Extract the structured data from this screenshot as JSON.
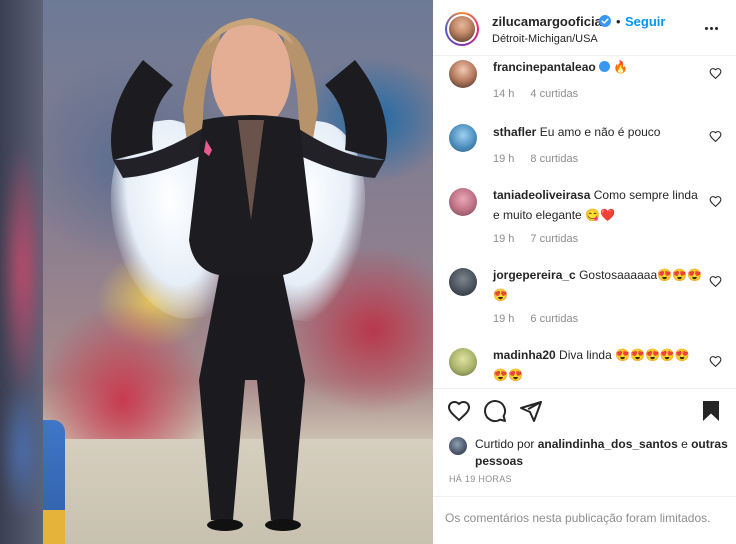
{
  "post": {
    "username": "zilucamargooficial",
    "dot": "•",
    "follow_label": "Seguir",
    "location": "Détroit-Michigan/USA"
  },
  "comments": [
    {
      "user": "francinepantaleao",
      "text": "🔥",
      "time": "14 h",
      "replies": "4 curtidas"
    },
    {
      "user": "sthafler",
      "text": "Eu amo e não é pouco",
      "time": "19 h",
      "replies": "8 curtidas"
    },
    {
      "user": "taniadeoliveirasa",
      "text": "Como sempre linda e muito elegante 😋❤️",
      "time": "19 h",
      "replies": "7 curtidas"
    },
    {
      "user": "jorgepereira_c",
      "text": "Gostosaaaaaa😍😍😍😍",
      "time": "19 h",
      "replies": "6 curtidas"
    },
    {
      "user": "madinha20",
      "text": "Diva linda 😍😍😍😍😍😍😍",
      "time": "",
      "replies": ""
    }
  ],
  "likes": {
    "prefix": "Curtido por ",
    "user": "analindinha_dos_santos",
    "middle": " e ",
    "others": "outras pessoas"
  },
  "timestamp": "HÁ 19 HORAS",
  "limited_notice": "Os comentários nesta publicação foram limitados.",
  "colors": {
    "accent": "#0095f6",
    "text": "#262626",
    "muted": "#8e8e8e"
  }
}
